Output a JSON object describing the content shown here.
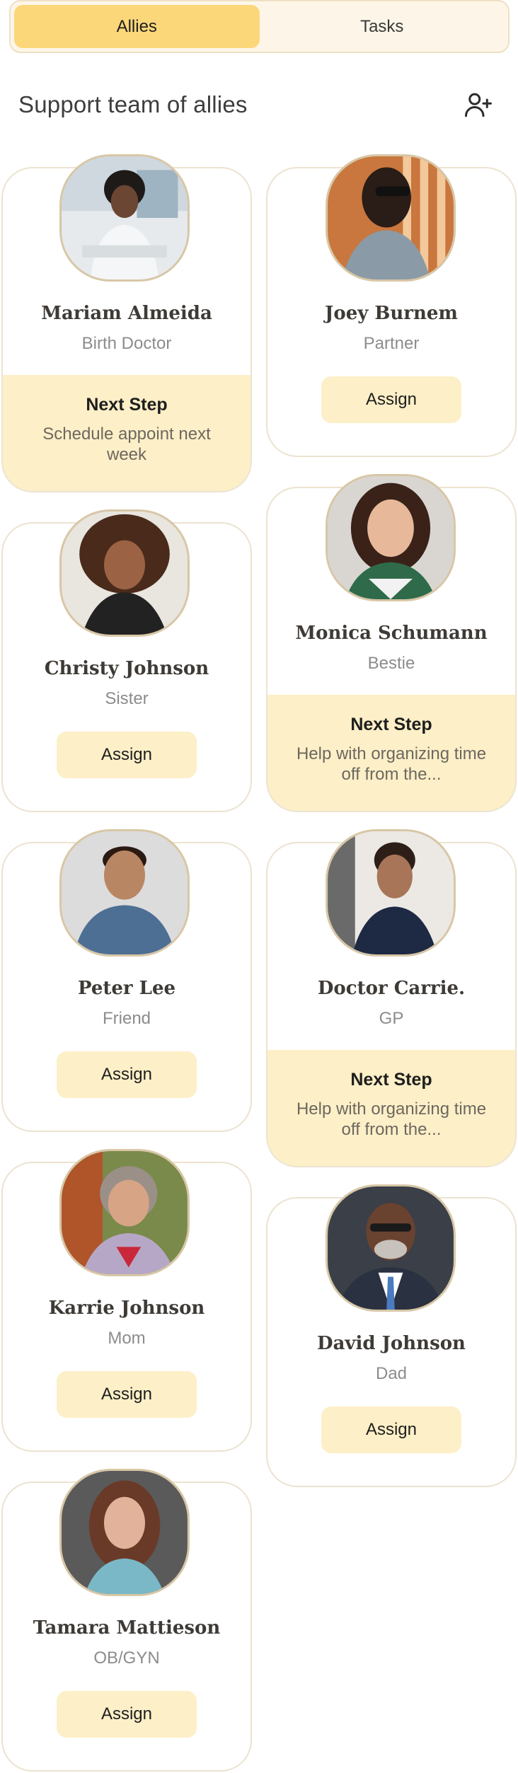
{
  "tabs": {
    "allies_label": "Allies",
    "tasks_label": "Tasks"
  },
  "header": {
    "title": "Support team of allies",
    "add_icon": "user-plus-icon"
  },
  "colors": {
    "accent": "#fcd77a",
    "accent_soft": "#fdefc7",
    "card_border": "#ece3d0"
  },
  "allies": [
    {
      "name": "Mariam  Almeida",
      "role": "Birth Doctor",
      "next_step_title": "Next Step",
      "next_step": "Schedule appoint next week"
    },
    {
      "name": "Joey Burnem",
      "role": "Partner",
      "assign_label": "Assign"
    },
    {
      "name": "Christy Johnson",
      "role": "Sister",
      "assign_label": "Assign"
    },
    {
      "name": "Monica Schumann",
      "role": "Bestie",
      "next_step_title": "Next Step",
      "next_step": "Help with organizing time off from the..."
    },
    {
      "name": "Peter Lee",
      "role": "Friend",
      "assign_label": "Assign"
    },
    {
      "name": "Doctor Carrie.",
      "role": "GP",
      "next_step_title": "Next Step",
      "next_step": "Help with organizing time off from the..."
    },
    {
      "name": "Karrie Johnson",
      "role": "Mom",
      "assign_label": "Assign"
    },
    {
      "name": "David Johnson",
      "role": "Dad",
      "assign_label": "Assign"
    },
    {
      "name": "Tamara Mattieson",
      "role": "OB/GYN",
      "assign_label": "Assign"
    }
  ]
}
